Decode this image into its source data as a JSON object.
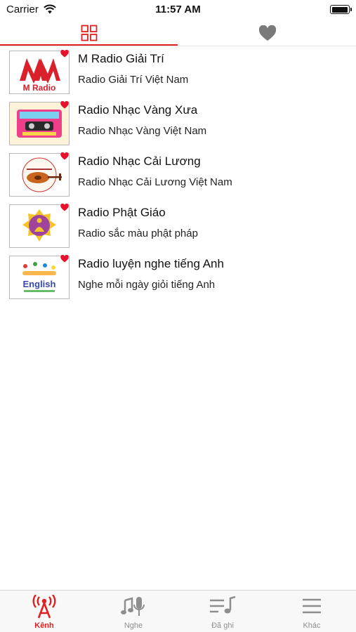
{
  "status_bar": {
    "carrier": "Carrier",
    "time": "11:57 AM",
    "wifi_icon": "wifi-icon",
    "battery_icon": "battery-icon",
    "battery_level": 0.9
  },
  "top_tabs": {
    "active": "grid",
    "items": [
      {
        "id": "grid",
        "icon": "grid-icon"
      },
      {
        "id": "favorites",
        "icon": "heart-icon"
      }
    ]
  },
  "channels": [
    {
      "title": "M Radio Giải Trí",
      "subtitle": "Radio Giải Trí Việt Nam",
      "logo_text": "M Radio",
      "favorite": true
    },
    {
      "title": "Radio Nhạc Vàng Xưa",
      "subtitle": "Radio Nhạc Vàng Việt Nam",
      "favorite": true
    },
    {
      "title": "Radio Nhạc Cải Lương",
      "subtitle": "Radio Nhạc Cải Lương Việt Nam",
      "favorite": true
    },
    {
      "title": "Radio Phật Giáo",
      "subtitle": "Radio sắc màu phật pháp",
      "favorite": true
    },
    {
      "title": "Radio luyện nghe tiếng Anh",
      "subtitle": "Nghe mỗi ngày giỏi tiếng Anh",
      "logo_text": "English",
      "favorite": true
    }
  ],
  "tab_bar": {
    "items": [
      {
        "label": "Kênh",
        "icon": "radio-tower-icon",
        "active": true
      },
      {
        "label": "Nghe",
        "icon": "music-mic-icon",
        "active": false
      },
      {
        "label": "Đã ghi",
        "icon": "playlist-icon",
        "active": false
      },
      {
        "label": "Khác",
        "icon": "menu-icon",
        "active": false
      }
    ]
  },
  "colors": {
    "accent": "#e02020",
    "inactive": "#8e8e8e",
    "favorite_heart": "#e8102a"
  }
}
